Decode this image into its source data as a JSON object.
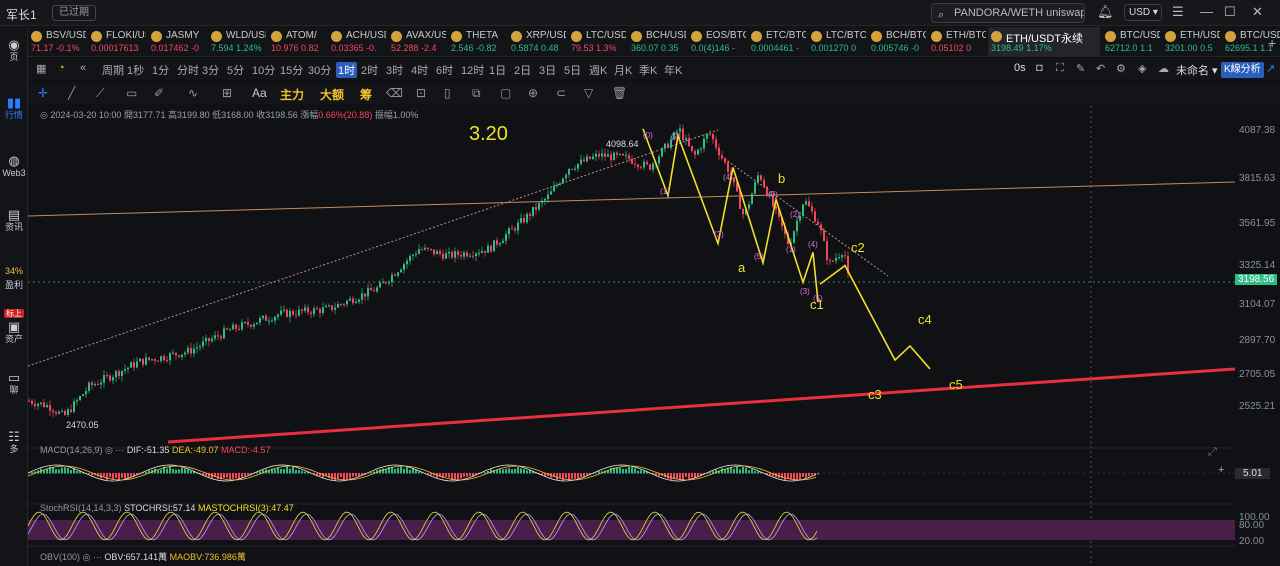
{
  "titlebar": {
    "app_name": "军长1",
    "badge": "已过期",
    "search_value": "PANDORA/WETH uniswap",
    "currency": "USD"
  },
  "ticker": [
    {
      "name": "BSV/USD",
      "price": "71.17",
      "change": "-0.1%",
      "dir": "dn"
    },
    {
      "name": "FLOKI/USD",
      "price": "0.00017613",
      "change": "",
      "dir": "dn"
    },
    {
      "name": "JASMY",
      "price": "0.017462",
      "change": "-0",
      "dir": "dn"
    },
    {
      "name": "WLD/USD",
      "price": "7.594",
      "change": "1.24%",
      "dir": "up"
    },
    {
      "name": "ATOM/",
      "price": "10.976",
      "change": "0.82",
      "dir": "dn"
    },
    {
      "name": "ACH/USD",
      "price": "0.03365",
      "change": "-0.",
      "dir": "dn"
    },
    {
      "name": "AVAX/USD",
      "price": "52.288",
      "change": "-2.4",
      "dir": "dn"
    },
    {
      "name": "THETA",
      "price": "2.546",
      "change": "-0.82",
      "dir": "up"
    },
    {
      "name": "XRP/USD",
      "price": "0.5874",
      "change": "0.48",
      "dir": "up"
    },
    {
      "name": "LTC/USD",
      "price": "79.53",
      "change": "1.3%",
      "dir": "dn"
    },
    {
      "name": "BCH/USD",
      "price": "360.07",
      "change": "0.35",
      "dir": "up"
    },
    {
      "name": "EOS/BTC",
      "price": "0.0(4)146",
      "change": "-",
      "dir": "up"
    },
    {
      "name": "ETC/BTC",
      "price": "0.0004461",
      "change": "-",
      "dir": "up"
    },
    {
      "name": "LTC/BTC",
      "price": "0.001270",
      "change": "0",
      "dir": "up"
    },
    {
      "name": "BCH/BTC",
      "price": "0.005746",
      "change": "-0",
      "dir": "up"
    },
    {
      "name": "ETH/BTC",
      "price": "0.05102",
      "change": "0",
      "dir": "dn"
    },
    {
      "name": "ETH/USDT永续",
      "price": "3198.49",
      "change": "1.17%",
      "dir": "up",
      "active": true
    },
    {
      "name": "BTC/USD",
      "price": "62712.0",
      "change": "1.1",
      "dir": "up"
    },
    {
      "name": "ETH/USD",
      "price": "3201.00",
      "change": "0.5",
      "dir": "up"
    },
    {
      "name": "BTC/USD",
      "price": "62695.1",
      "change": "1.1",
      "dir": "up"
    }
  ],
  "sidebar": [
    {
      "label": "页",
      "icon": "logo-icon"
    },
    {
      "label": "行情",
      "icon": "chart-icon"
    },
    {
      "label": "Web3",
      "icon": "web3-icon"
    },
    {
      "label": "资讯",
      "icon": "news-icon"
    },
    {
      "label": "盈利",
      "icon": "profit-icon"
    },
    {
      "label": "资产",
      "icon": "asset-icon"
    },
    {
      "label": "聊",
      "icon": "chat-icon"
    },
    {
      "label": "多",
      "icon": "more-icon"
    }
  ],
  "sidebar_misc": {
    "pct": "34%",
    "tag": "标上"
  },
  "timeframes": [
    "周期",
    "1秒",
    "1分",
    "分时",
    "3分",
    "5分",
    "10分",
    "15分",
    "30分",
    "1时",
    "2时",
    "3时",
    "4时",
    "6时",
    "12时",
    "1日",
    "2日",
    "3日",
    "5日",
    "週K",
    "月K",
    "季K",
    "年K"
  ],
  "active_timeframe": "1时",
  "topright": {
    "delay": "0s",
    "layout_name": "未命名",
    "kline_btn": "K線分析"
  },
  "drawtools": {
    "text_tool": "Aa",
    "main_force": "主力",
    "big_order": "大额",
    "chip": "筹"
  },
  "ohlc": {
    "date": "2024-03-20 10:00",
    "open_label": "開",
    "open": "3177.71",
    "high_label": "高",
    "high": "3199.80",
    "low_label": "低",
    "low": "3168.00",
    "close_label": "收",
    "close": "3198.56",
    "chg_label": "漲幅",
    "chg": "0.66%(20.88)",
    "amp_label": "振幅",
    "amp": "1.00%"
  },
  "annotation": {
    "date": "3.20",
    "high_label": "4098.64",
    "low_label": "2470.05",
    "wave_labels": [
      "a",
      "b",
      "c1",
      "c2",
      "c3",
      "c4",
      "c5"
    ]
  },
  "yaxis": [
    "4087.38",
    "3815.63",
    "3561.95",
    "3325.14",
    "3104.07",
    "2897.70",
    "2705.05",
    "2525.21"
  ],
  "current_price": "3198.56",
  "macd": {
    "name": "MACD(14,26,9)",
    "dif": "DIF:-51.35",
    "dea": "DEA:-49.07",
    "macd": "MACD:-4.57",
    "scale": "5.01"
  },
  "stochrsi": {
    "name": "StochRSI(14,14,3,3)",
    "stoch": "STOCHRSI:57.14",
    "ma": "MASTOCHRSI(3):47.47",
    "levels": [
      "100.00",
      "80.00",
      "20.00"
    ]
  },
  "obv": {
    "name": "OBV(100)",
    "obv": "OBV:657.141萬",
    "ma": "MAOBV:736.986萬"
  },
  "chart_data": {
    "type": "line",
    "title": "",
    "price_path": [
      [
        0,
        2560
      ],
      [
        20,
        2530
      ],
      [
        35,
        2470
      ],
      [
        60,
        2640
      ],
      [
        110,
        2780
      ],
      [
        160,
        2840
      ],
      [
        200,
        2960
      ],
      [
        250,
        3050
      ],
      [
        300,
        3080
      ],
      [
        350,
        3200
      ],
      [
        390,
        3420
      ],
      [
        420,
        3380
      ],
      [
        460,
        3420
      ],
      [
        490,
        3560
      ],
      [
        520,
        3720
      ],
      [
        540,
        3880
      ],
      [
        570,
        3950
      ],
      [
        600,
        3930
      ],
      [
        620,
        3880
      ],
      [
        640,
        4020
      ],
      [
        650,
        4098.64
      ],
      [
        665,
        3940
      ],
      [
        680,
        4080
      ],
      [
        700,
        3860
      ],
      [
        715,
        3600
      ],
      [
        730,
        3850
      ],
      [
        745,
        3650
      ],
      [
        760,
        3440
      ],
      [
        775,
        3700
      ],
      [
        790,
        3560
      ],
      [
        800,
        3330
      ],
      [
        815,
        3420
      ],
      [
        820,
        3220
      ]
    ],
    "projection": [
      [
        820,
        3220
      ],
      [
        845,
        3325
      ],
      [
        895,
        2790
      ],
      [
        910,
        2870
      ],
      [
        930,
        2740
      ]
    ],
    "ylim": [
      2400,
      4200
    ]
  }
}
